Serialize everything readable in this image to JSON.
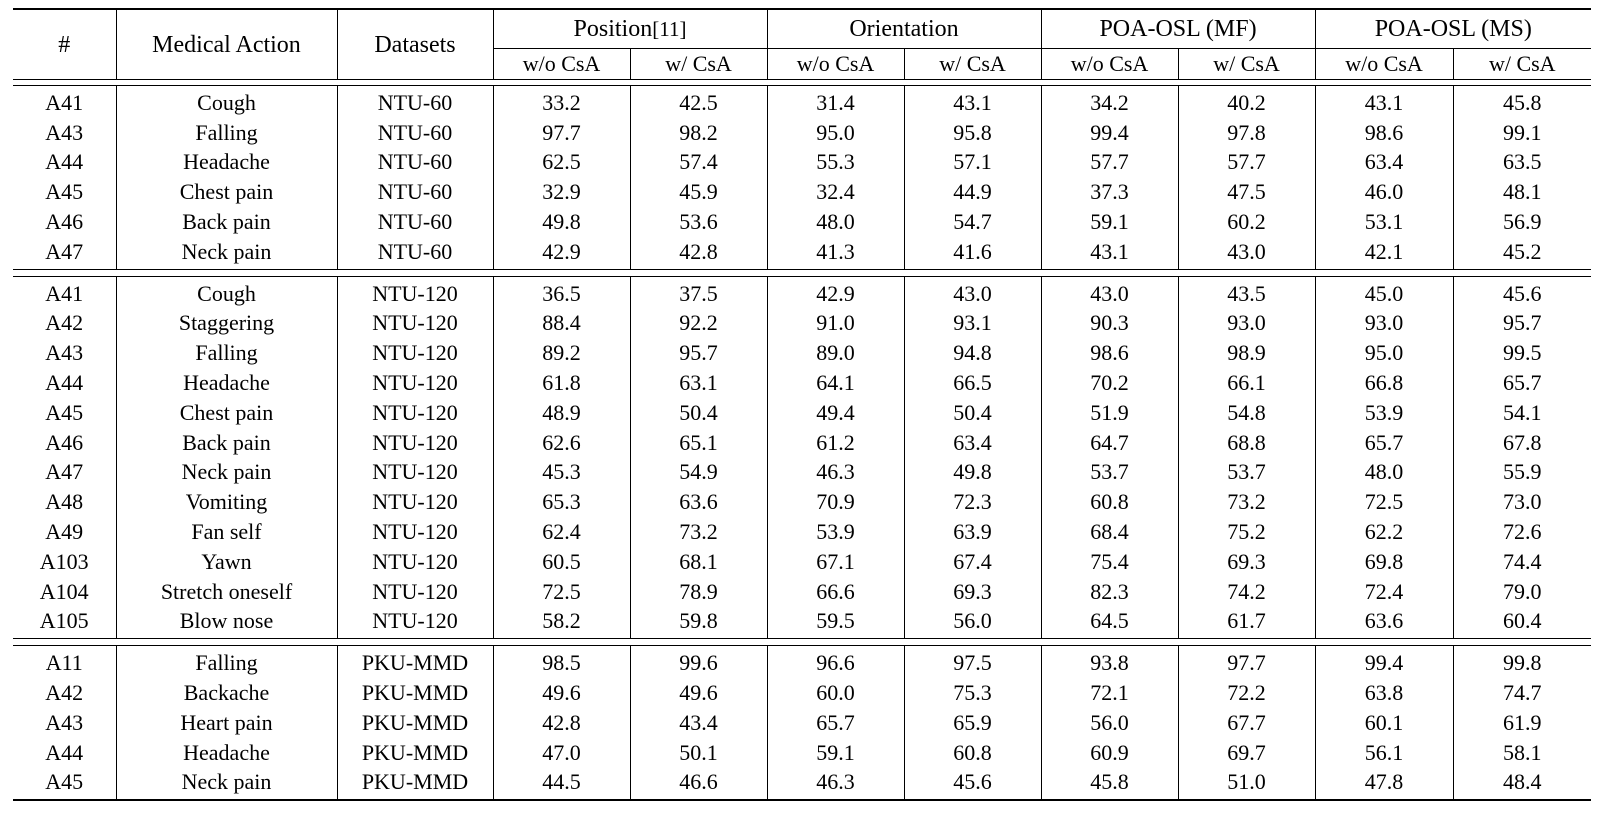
{
  "table": {
    "header": {
      "col_index": "#",
      "col_action": "Medical Action",
      "col_datasets": "Datasets",
      "groups": [
        {
          "name": "Position",
          "ref": "[11]"
        },
        {
          "name": "Orientation",
          "ref": ""
        },
        {
          "name": "POA-OSL (MF)",
          "ref": ""
        },
        {
          "name": "POA-OSL (MS)",
          "ref": ""
        }
      ],
      "sub_without": "w/o CsA",
      "sub_with": "w/ CsA"
    },
    "blocks": [
      {
        "dataset": "NTU-60",
        "rows": [
          {
            "id": "A41",
            "action": "Cough",
            "dataset": "NTU-60",
            "values": [
              "33.2",
              "42.5",
              "31.4",
              "43.1",
              "34.2",
              "40.2",
              "43.1",
              "45.8"
            ],
            "bold": [
              false,
              false,
              false,
              false,
              false,
              false,
              false,
              true
            ]
          },
          {
            "id": "A43",
            "action": "Falling",
            "dataset": "NTU-60",
            "values": [
              "97.7",
              "98.2",
              "95.0",
              "95.8",
              "99.4",
              "97.8",
              "98.6",
              "99.1"
            ],
            "bold": [
              false,
              false,
              false,
              false,
              true,
              false,
              false,
              false
            ]
          },
          {
            "id": "A44",
            "action": "Headache",
            "dataset": "NTU-60",
            "values": [
              "62.5",
              "57.4",
              "55.3",
              "57.1",
              "57.7",
              "57.7",
              "63.4",
              "63.5"
            ],
            "bold": [
              false,
              false,
              false,
              false,
              false,
              false,
              false,
              true
            ]
          },
          {
            "id": "A45",
            "action": "Chest pain",
            "dataset": "NTU-60",
            "values": [
              "32.9",
              "45.9",
              "32.4",
              "44.9",
              "37.3",
              "47.5",
              "46.0",
              "48.1"
            ],
            "bold": [
              false,
              false,
              false,
              false,
              false,
              false,
              false,
              true
            ]
          },
          {
            "id": "A46",
            "action": "Back pain",
            "dataset": "NTU-60",
            "values": [
              "49.8",
              "53.6",
              "48.0",
              "54.7",
              "59.1",
              "60.2",
              "53.1",
              "56.9"
            ],
            "bold": [
              false,
              false,
              false,
              false,
              false,
              true,
              false,
              false
            ]
          },
          {
            "id": "A47",
            "action": "Neck pain",
            "dataset": "NTU-60",
            "values": [
              "42.9",
              "42.8",
              "41.3",
              "41.6",
              "43.1",
              "43.0",
              "42.1",
              "45.2"
            ],
            "bold": [
              false,
              false,
              false,
              false,
              false,
              false,
              false,
              true
            ]
          }
        ]
      },
      {
        "dataset": "NTU-120",
        "rows": [
          {
            "id": "A41",
            "action": "Cough",
            "dataset": "NTU-120",
            "values": [
              "36.5",
              "37.5",
              "42.9",
              "43.0",
              "43.0",
              "43.5",
              "45.0",
              "45.6"
            ],
            "bold": [
              false,
              false,
              false,
              false,
              false,
              false,
              false,
              true
            ]
          },
          {
            "id": "A42",
            "action": "Staggering",
            "dataset": "NTU-120",
            "values": [
              "88.4",
              "92.2",
              "91.0",
              "93.1",
              "90.3",
              "93.0",
              "93.0",
              "95.7"
            ],
            "bold": [
              false,
              false,
              false,
              false,
              false,
              false,
              false,
              true
            ]
          },
          {
            "id": "A43",
            "action": "Falling",
            "dataset": "NTU-120",
            "values": [
              "89.2",
              "95.7",
              "89.0",
              "94.8",
              "98.6",
              "98.9",
              "95.0",
              "99.5"
            ],
            "bold": [
              false,
              false,
              false,
              false,
              false,
              false,
              false,
              true
            ]
          },
          {
            "id": "A44",
            "action": "Headache",
            "dataset": "NTU-120",
            "values": [
              "61.8",
              "63.1",
              "64.1",
              "66.5",
              "70.2",
              "66.1",
              "66.8",
              "65.7"
            ],
            "bold": [
              false,
              false,
              false,
              false,
              true,
              false,
              false,
              false
            ]
          },
          {
            "id": "A45",
            "action": "Chest pain",
            "dataset": "NTU-120",
            "values": [
              "48.9",
              "50.4",
              "49.4",
              "50.4",
              "51.9",
              "54.8",
              "53.9",
              "54.1"
            ],
            "bold": [
              false,
              false,
              false,
              false,
              false,
              true,
              false,
              false
            ]
          },
          {
            "id": "A46",
            "action": "Back pain",
            "dataset": "NTU-120",
            "values": [
              "62.6",
              "65.1",
              "61.2",
              "63.4",
              "64.7",
              "68.8",
              "65.7",
              "67.8"
            ],
            "bold": [
              false,
              false,
              false,
              false,
              false,
              true,
              false,
              false
            ]
          },
          {
            "id": "A47",
            "action": "Neck pain",
            "dataset": "NTU-120",
            "values": [
              "45.3",
              "54.9",
              "46.3",
              "49.8",
              "53.7",
              "53.7",
              "48.0",
              "55.9"
            ],
            "bold": [
              false,
              false,
              false,
              false,
              false,
              false,
              false,
              true
            ]
          },
          {
            "id": "A48",
            "action": "Vomiting",
            "dataset": "NTU-120",
            "values": [
              "65.3",
              "63.6",
              "70.9",
              "72.3",
              "60.8",
              "73.2",
              "72.5",
              "73.0"
            ],
            "bold": [
              false,
              false,
              false,
              false,
              false,
              true,
              false,
              false
            ]
          },
          {
            "id": "A49",
            "action": "Fan self",
            "dataset": "NTU-120",
            "values": [
              "62.4",
              "73.2",
              "53.9",
              "63.9",
              "68.4",
              "75.2",
              "62.2",
              "72.6"
            ],
            "bold": [
              false,
              false,
              false,
              false,
              false,
              true,
              false,
              false
            ]
          },
          {
            "id": "A103",
            "action": "Yawn",
            "dataset": "NTU-120",
            "values": [
              "60.5",
              "68.1",
              "67.1",
              "67.4",
              "75.4",
              "69.3",
              "69.8",
              "74.4"
            ],
            "bold": [
              false,
              false,
              false,
              false,
              true,
              false,
              false,
              false
            ]
          },
          {
            "id": "A104",
            "action": "Stretch oneself",
            "dataset": "NTU-120",
            "values": [
              "72.5",
              "78.9",
              "66.6",
              "69.3",
              "82.3",
              "74.2",
              "72.4",
              "79.0"
            ],
            "bold": [
              false,
              false,
              false,
              false,
              true,
              false,
              false,
              false
            ]
          },
          {
            "id": "A105",
            "action": "Blow nose",
            "dataset": "NTU-120",
            "values": [
              "58.2",
              "59.8",
              "59.5",
              "56.0",
              "64.5",
              "61.7",
              "63.6",
              "60.4"
            ],
            "bold": [
              false,
              false,
              false,
              false,
              true,
              false,
              false,
              false
            ]
          }
        ]
      },
      {
        "dataset": "PKU-MMD",
        "rows": [
          {
            "id": "A11",
            "action": "Falling",
            "dataset": "PKU-MMD",
            "values": [
              "98.5",
              "99.6",
              "96.6",
              "97.5",
              "93.8",
              "97.7",
              "99.4",
              "99.8"
            ],
            "bold": [
              false,
              false,
              false,
              false,
              false,
              false,
              false,
              true
            ]
          },
          {
            "id": "A42",
            "action": "Backache",
            "dataset": "PKU-MMD",
            "values": [
              "49.6",
              "49.6",
              "60.0",
              "75.3",
              "72.1",
              "72.2",
              "63.8",
              "74.7"
            ],
            "bold": [
              false,
              false,
              false,
              true,
              false,
              false,
              false,
              false
            ]
          },
          {
            "id": "A43",
            "action": "Heart pain",
            "dataset": "PKU-MMD",
            "values": [
              "42.8",
              "43.4",
              "65.7",
              "65.9",
              "56.0",
              "67.7",
              "60.1",
              "61.9"
            ],
            "bold": [
              false,
              false,
              false,
              false,
              false,
              true,
              false,
              false
            ]
          },
          {
            "id": "A44",
            "action": "Headache",
            "dataset": "PKU-MMD",
            "values": [
              "47.0",
              "50.1",
              "59.1",
              "60.8",
              "60.9",
              "69.7",
              "56.1",
              "58.1"
            ],
            "bold": [
              false,
              false,
              false,
              false,
              false,
              true,
              false,
              false
            ]
          },
          {
            "id": "A45",
            "action": "Neck pain",
            "dataset": "PKU-MMD",
            "values": [
              "44.5",
              "46.6",
              "46.3",
              "45.6",
              "45.8",
              "51.0",
              "47.8",
              "48.4"
            ],
            "bold": [
              false,
              false,
              false,
              false,
              false,
              true,
              false,
              false
            ]
          }
        ]
      }
    ]
  }
}
